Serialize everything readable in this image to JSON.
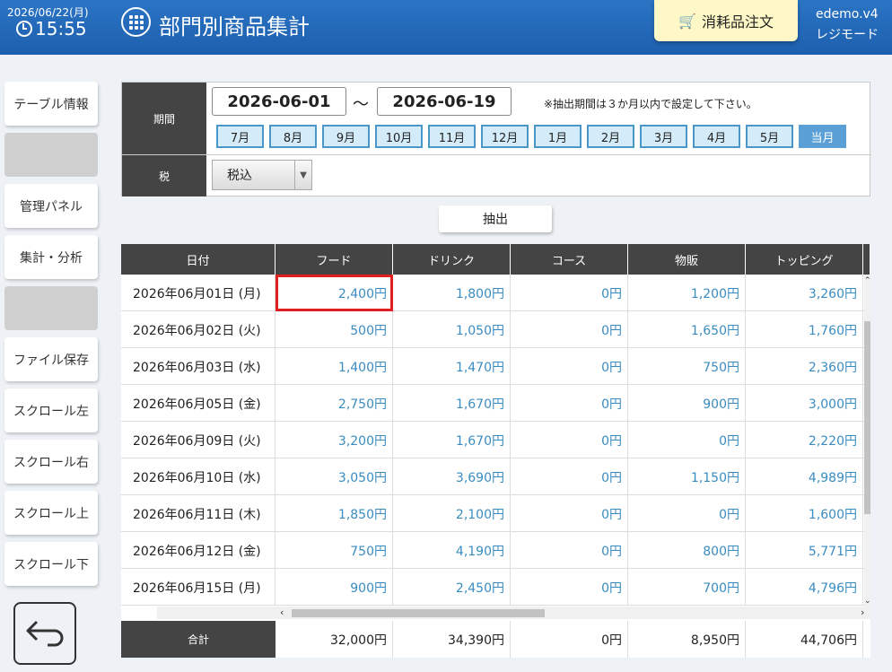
{
  "header": {
    "date": "2026/06/22(月)",
    "time": "15:55",
    "title": "部門別商品集計",
    "order_button": "消耗品注文",
    "user": "edemo.v4",
    "mode": "レジモード"
  },
  "sidebar": {
    "items": [
      "テーブル情報",
      "",
      "管理パネル",
      "集計・分析",
      "",
      "ファイル保存",
      "スクロール左",
      "スクロール右",
      "スクロール上",
      "スクロール下"
    ]
  },
  "filter": {
    "period_label": "期間",
    "start_date": "2026-06-01",
    "tilde": "～",
    "end_date": "2026-06-19",
    "note": "※抽出期間は３か月以内で設定して下さい。",
    "months": [
      "7月",
      "8月",
      "9月",
      "10月",
      "11月",
      "12月",
      "1月",
      "2月",
      "3月",
      "4月",
      "5月",
      "当月"
    ],
    "active_month": "当月",
    "tax_label": "税",
    "tax_value": "税込"
  },
  "extract_button": "抽出",
  "table": {
    "columns": [
      "日付",
      "フード",
      "ドリンク",
      "コース",
      "物販",
      "トッピング"
    ],
    "rows": [
      [
        "2026年06月01日 (月)",
        "2,400円",
        "1,800円",
        "0円",
        "1,200円",
        "3,260円"
      ],
      [
        "2026年06月02日 (火)",
        "500円",
        "1,050円",
        "0円",
        "1,650円",
        "1,760円"
      ],
      [
        "2026年06月03日 (水)",
        "1,400円",
        "1,470円",
        "0円",
        "750円",
        "2,360円"
      ],
      [
        "2026年06月05日 (金)",
        "2,750円",
        "1,670円",
        "0円",
        "900円",
        "3,000円"
      ],
      [
        "2026年06月09日 (火)",
        "3,200円",
        "1,670円",
        "0円",
        "0円",
        "2,220円"
      ],
      [
        "2026年06月10日 (水)",
        "3,050円",
        "3,690円",
        "0円",
        "1,150円",
        "4,989円"
      ],
      [
        "2026年06月11日 (木)",
        "1,850円",
        "2,100円",
        "0円",
        "0円",
        "1,600円"
      ],
      [
        "2026年06月12日 (金)",
        "750円",
        "4,190円",
        "0円",
        "800円",
        "5,771円"
      ],
      [
        "2026年06月15日 (月)",
        "900円",
        "2,450円",
        "0円",
        "700円",
        "4,796円"
      ]
    ],
    "total_label": "合計",
    "totals": [
      "32,000円",
      "34,390円",
      "0円",
      "8,950円",
      "44,706円"
    ]
  },
  "colors": {
    "header_blue": "#2b74c4",
    "value_blue": "#3a8cc0",
    "highlight_red": "#e02020",
    "order_yellow": "#fdf8c6"
  }
}
